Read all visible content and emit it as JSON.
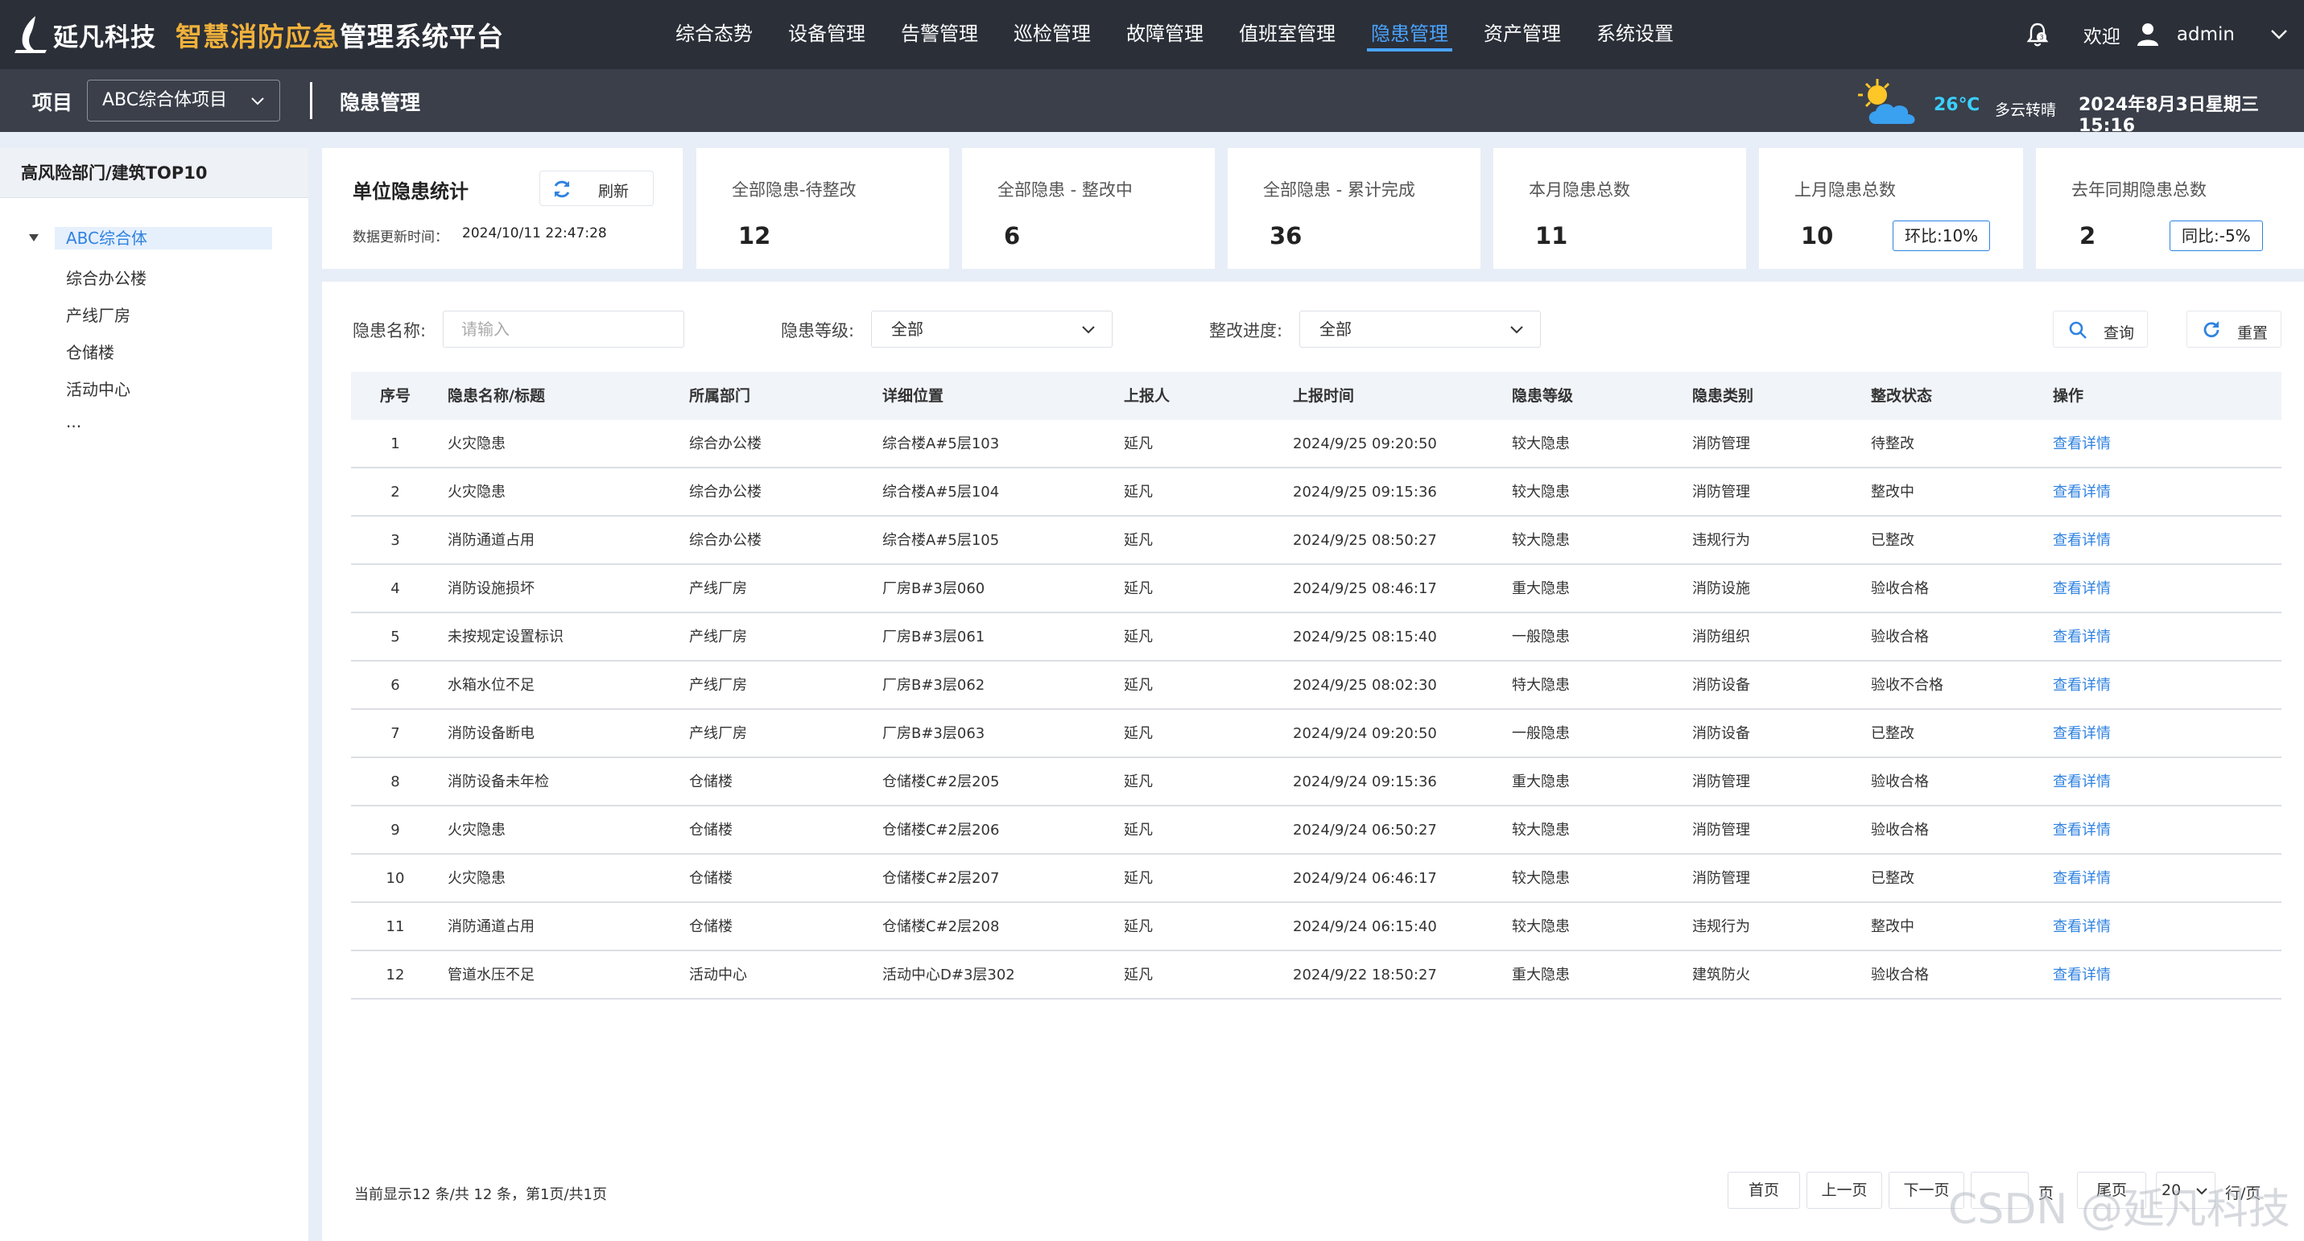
{
  "brand": {
    "name": "延凡科技",
    "system_title_a": "智慧消防应急",
    "system_title_b": "管理系统平台"
  },
  "nav": [
    {
      "label": "综合态势"
    },
    {
      "label": "设备管理"
    },
    {
      "label": "告警管理"
    },
    {
      "label": "巡检管理"
    },
    {
      "label": "故障管理"
    },
    {
      "label": "值班室管理"
    },
    {
      "label": "隐患管理",
      "active": true
    },
    {
      "label": "资产管理"
    },
    {
      "label": "系统设置"
    }
  ],
  "user": {
    "welcome": "欢迎",
    "name": "admin"
  },
  "subheader": {
    "project_label": "项目",
    "project_value": "ABC综合体项目",
    "page_title": "隐患管理",
    "temperature": "26℃",
    "weather": "多云转晴",
    "datetime": "2024年8月3日星期三 15:16"
  },
  "sidebar": {
    "title": "高风险部门/建筑TOP10",
    "root": "ABC综合体",
    "children": [
      "综合办公楼",
      "产线厂房",
      "仓储楼",
      "活动中心",
      "..."
    ]
  },
  "stats": {
    "unit_title": "单位隐患统计",
    "refresh_label": "刷新",
    "update_label": "数据更新时间：",
    "update_time": "2024/10/11 22:47:28",
    "cards": [
      {
        "title": "全部隐患-待整改",
        "value": "12",
        "badge": ""
      },
      {
        "title": "全部隐患 - 整改中",
        "value": "6",
        "badge": ""
      },
      {
        "title": "全部隐患 - 累计完成",
        "value": "36",
        "badge": ""
      },
      {
        "title": "本月隐患总数",
        "value": "11",
        "badge": ""
      },
      {
        "title": "上月隐患总数",
        "value": "10",
        "badge": "环比:10%"
      },
      {
        "title": "去年同期隐患总数",
        "value": "2",
        "badge": "同比:-5%"
      }
    ]
  },
  "filters": {
    "name_label": "隐患名称:",
    "name_placeholder": "请输入",
    "level_label": "隐患等级:",
    "level_value": "全部",
    "progress_label": "整改进度:",
    "progress_value": "全部",
    "query_label": "查询",
    "reset_label": "重置"
  },
  "table": {
    "headers": [
      "序号",
      "隐患名称/标题",
      "所属部门",
      "详细位置",
      "上报人",
      "上报时间",
      "隐患等级",
      "隐患类别",
      "整改状态",
      "操作"
    ],
    "rows": [
      [
        "1",
        "火灾隐患",
        "综合办公楼",
        "综合楼A#5层103",
        "延凡",
        "2024/9/25 09:20:50",
        "较大隐患",
        "消防管理",
        "待整改",
        "查看详情"
      ],
      [
        "2",
        "火灾隐患",
        "综合办公楼",
        "综合楼A#5层104",
        "延凡",
        "2024/9/25 09:15:36",
        "较大隐患",
        "消防管理",
        "整改中",
        "查看详情"
      ],
      [
        "3",
        "消防通道占用",
        "综合办公楼",
        "综合楼A#5层105",
        "延凡",
        "2024/9/25 08:50:27",
        "较大隐患",
        "违规行为",
        "已整改",
        "查看详情"
      ],
      [
        "4",
        "消防设施损坏",
        "产线厂房",
        "厂房B#3层060",
        "延凡",
        "2024/9/25 08:46:17",
        "重大隐患",
        "消防设施",
        "验收合格",
        "查看详情"
      ],
      [
        "5",
        "未按规定设置标识",
        "产线厂房",
        "厂房B#3层061",
        "延凡",
        "2024/9/25 08:15:40",
        "一般隐患",
        "消防组织",
        "验收合格",
        "查看详情"
      ],
      [
        "6",
        "水箱水位不足",
        "产线厂房",
        "厂房B#3层062",
        "延凡",
        "2024/9/25 08:02:30",
        "特大隐患",
        "消防设备",
        "验收不合格",
        "查看详情"
      ],
      [
        "7",
        "消防设备断电",
        "产线厂房",
        "厂房B#3层063",
        "延凡",
        "2024/9/24 09:20:50",
        "一般隐患",
        "消防设备",
        "已整改",
        "查看详情"
      ],
      [
        "8",
        "消防设备未年检",
        "仓储楼",
        "仓储楼C#2层205",
        "延凡",
        "2024/9/24 09:15:36",
        "重大隐患",
        "消防管理",
        "验收合格",
        "查看详情"
      ],
      [
        "9",
        "火灾隐患",
        "仓储楼",
        "仓储楼C#2层206",
        "延凡",
        "2024/9/24 06:50:27",
        "较大隐患",
        "消防管理",
        "验收合格",
        "查看详情"
      ],
      [
        "10",
        "火灾隐患",
        "仓储楼",
        "仓储楼C#2层207",
        "延凡",
        "2024/9/24 06:46:17",
        "较大隐患",
        "消防管理",
        "已整改",
        "查看详情"
      ],
      [
        "11",
        "消防通道占用",
        "仓储楼",
        "仓储楼C#2层208",
        "延凡",
        "2024/9/24 06:15:40",
        "较大隐患",
        "违规行为",
        "整改中",
        "查看详情"
      ],
      [
        "12",
        "管道水压不足",
        "活动中心",
        "活动中心D#3层302",
        "延凡",
        "2024/9/22 18:50:27",
        "重大隐患",
        "建筑防火",
        "验收合格",
        "查看详情"
      ]
    ]
  },
  "pagination": {
    "info": "当前显示12 条/共 12 条，第1页/共1页",
    "first": "首页",
    "prev": "上一页",
    "next": "下一页",
    "page_suffix": "页",
    "last": "尾页",
    "page_size": "20",
    "per_page": "行/页"
  },
  "watermark": "CSDN @延凡科技",
  "colors": {
    "topbar": "#2b2f38",
    "subbar": "#3a3f4a",
    "brand_orange": "#f0b13a",
    "accent_blue": "#2f82e0",
    "nav_active": "#4aa3ff",
    "temp": "#3ad0ff"
  }
}
